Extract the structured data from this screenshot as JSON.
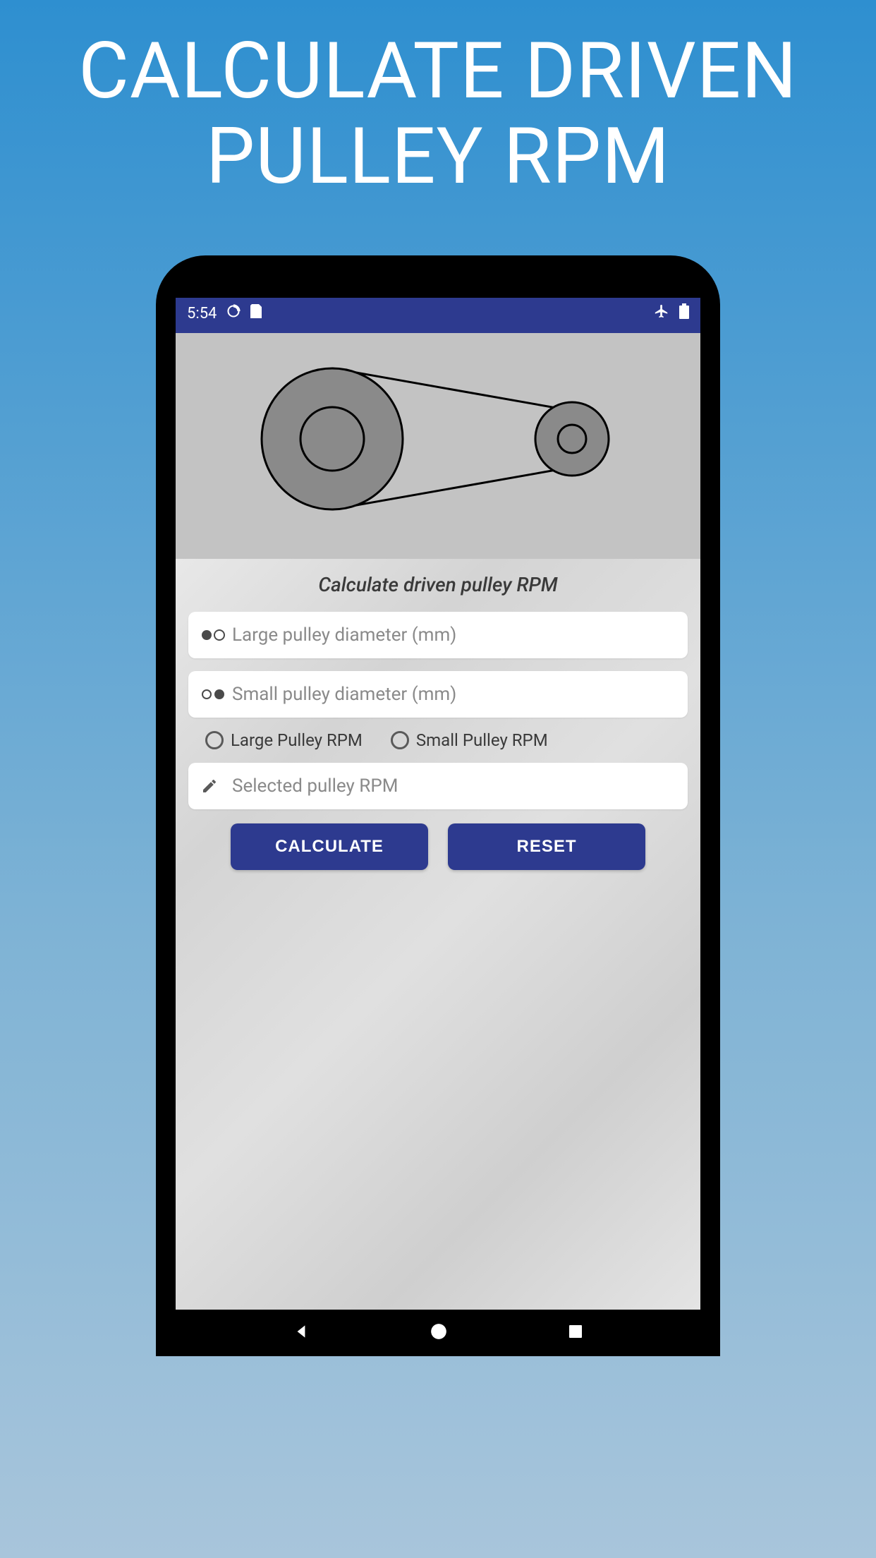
{
  "promo": {
    "title_l1": "CALCULATE DRIVEN",
    "title_l2": "PULLEY RPM"
  },
  "status": {
    "time": "5:54"
  },
  "section": {
    "title": "Calculate driven pulley RPM"
  },
  "inputs": {
    "large_diameter_placeholder": "Large pulley diameter (mm)",
    "small_diameter_placeholder": "Small pulley diameter (mm)",
    "selected_rpm_placeholder": "Selected pulley RPM"
  },
  "radios": {
    "large_label": "Large Pulley RPM",
    "small_label": "Small Pulley RPM"
  },
  "buttons": {
    "calculate": "CALCULATE",
    "reset": "RESET"
  }
}
